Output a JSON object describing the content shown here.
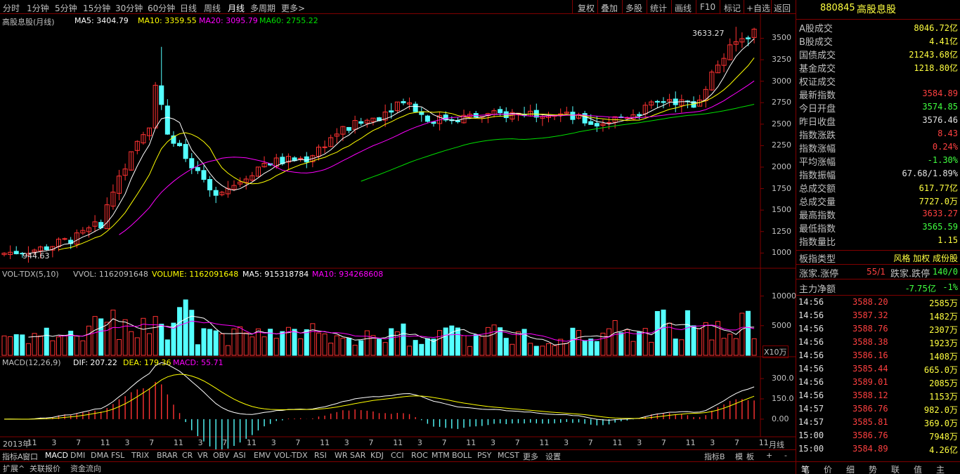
{
  "toolbar": {
    "periods": [
      "分时",
      "1分钟",
      "5分钟",
      "15分钟",
      "30分钟",
      "60分钟",
      "日线",
      "周线",
      "月线",
      "多周期",
      "更多>"
    ],
    "right": [
      "复权",
      "叠加",
      "多股",
      "统计",
      "画线",
      "F10",
      "标记",
      "+自选",
      "返回"
    ]
  },
  "main_legend": {
    "name": "高股息股(月线)",
    "ma5": "MA5: 3404.79",
    "ma10": "MA10: 3359.55",
    "ma20": "MA20: 3095.79",
    "ma60": "MA60: 2755.22"
  },
  "annotations": {
    "high": "3633.27",
    "low": "944.63"
  },
  "vol_legend": {
    "name": "VOL-TDX(5,10)",
    "vvol": "VVOL: 1162091648",
    "volume": "VOLUME: 1162091648",
    "ma5": "MA5: 915318784",
    "ma10": "MA10: 934268608"
  },
  "vol_unit": "X10万",
  "macd_legend": {
    "name": "MACD(12,26,9)",
    "dif": "DIF: 207.22",
    "dea": "DEA: 179.36",
    "macd": "MACD: 55.71"
  },
  "colors": {
    "up": "#ff3232",
    "down": "#54ffff",
    "ma5": "#ffffff",
    "ma10": "#ffff00",
    "ma20": "#ff00ff",
    "ma60": "#00e000",
    "axis": "#800000"
  },
  "chart_data": {
    "type": "candlestick",
    "title": "高股息股(月线)",
    "ylim": [
      944.63,
      3633.27
    ],
    "price_ticks": [
      "3500",
      "3250",
      "3000",
      "2750",
      "2500",
      "2250",
      "2000",
      "1750",
      "1500",
      "1250",
      "1000"
    ],
    "vol_ticks": [
      "10000",
      "5000"
    ],
    "macd_ticks": [
      "300.0",
      "150.0",
      "0.00"
    ],
    "x_ticks": [
      "2013年",
      "11",
      "3",
      "7",
      "11",
      "3",
      "7",
      "11",
      "3",
      "7",
      "11",
      "3",
      "7",
      "11",
      "3",
      "7",
      "11",
      "3",
      "7",
      "11",
      "3",
      "7",
      "11",
      "3",
      "7",
      "11",
      "3",
      "7",
      "11",
      "3",
      "7",
      "11"
    ],
    "x_period_label": "月线",
    "ma_last": {
      "MA5": 3404.79,
      "MA10": 3359.55,
      "MA20": 3095.79,
      "MA60": 2755.22
    }
  },
  "bottom_tabs": [
    "指标A",
    "窗口",
    "MACD",
    "DMI",
    "DMA",
    "FSL",
    "TRIX",
    "BRAR",
    "CR",
    "VR",
    "OBV",
    "ASI",
    "EMV",
    "VOL-TDX",
    "RSI",
    "WR",
    "SAR",
    "KDJ",
    "CCI",
    "ROC",
    "MTM",
    "BOLL",
    "PSY",
    "MCST",
    "更多",
    "设置"
  ],
  "bottom_tabs_right": [
    "指标B",
    "模",
    "板",
    "+",
    "-"
  ],
  "bottom_row2": [
    "扩展^",
    "关联报价",
    "资金流向"
  ],
  "panel": {
    "code": "880845",
    "name": "高股息股",
    "rows": [
      {
        "k": "A股成交",
        "v": "8046.72亿",
        "c": "#ffff40"
      },
      {
        "k": "B股成交",
        "v": "4.41亿",
        "c": "#ffff40"
      },
      {
        "k": "国债成交",
        "v": "21243.68亿",
        "c": "#ffff40"
      },
      {
        "k": "基金成交",
        "v": "1218.80亿",
        "c": "#ffff40"
      },
      {
        "k": "权证成交",
        "v": "",
        "c": "#ffff40"
      },
      {
        "k": "最新指数",
        "v": "3584.89",
        "c": "#ff4040"
      },
      {
        "k": "今日开盘",
        "v": "3574.85",
        "c": "#40ff40"
      },
      {
        "k": "昨日收盘",
        "v": "3576.46",
        "c": "#e0e0e0"
      },
      {
        "k": "指数涨跌",
        "v": "8.43",
        "c": "#ff4040"
      },
      {
        "k": "指数涨幅",
        "v": "0.24%",
        "c": "#ff4040"
      },
      {
        "k": "平均涨幅",
        "v": "-1.30%",
        "c": "#40ff40"
      },
      {
        "k": "指数振幅",
        "v": "67.68/1.89%",
        "c": "#e0e0e0"
      },
      {
        "k": "总成交额",
        "v": "617.77亿",
        "c": "#ffff40"
      },
      {
        "k": "总成交量",
        "v": "7727.0万",
        "c": "#ffff40"
      },
      {
        "k": "最高指数",
        "v": "3633.27",
        "c": "#ff4040"
      },
      {
        "k": "最低指数",
        "v": "3565.59",
        "c": "#40ff40"
      },
      {
        "k": "指数量比",
        "v": "1.15",
        "c": "#ffff40"
      }
    ],
    "type_row": {
      "k": "板指类型",
      "v": "风格 加权 成份股"
    },
    "updown": {
      "k1": "涨家.涨停",
      "v1": "55/1",
      "k2": "跌家.跌停",
      "v2": "140/0"
    },
    "netflow": {
      "k": "主力净额",
      "v1": "-7.75亿",
      "v2": "-1%"
    },
    "ticks": [
      {
        "t": "14:56",
        "p": "3588.20",
        "q": "2585万"
      },
      {
        "t": "14:56",
        "p": "3587.32",
        "q": "1482万"
      },
      {
        "t": "14:56",
        "p": "3588.76",
        "q": "2307万"
      },
      {
        "t": "14:56",
        "p": "3588.38",
        "q": "1923万"
      },
      {
        "t": "14:56",
        "p": "3586.16",
        "q": "1408万"
      },
      {
        "t": "14:56",
        "p": "3585.44",
        "q": "665.0万"
      },
      {
        "t": "14:56",
        "p": "3589.01",
        "q": "2085万"
      },
      {
        "t": "14:56",
        "p": "3588.12",
        "q": "1153万"
      },
      {
        "t": "14:57",
        "p": "3586.76",
        "q": "982.0万"
      },
      {
        "t": "14:57",
        "p": "3585.81",
        "q": "369.0万"
      },
      {
        "t": "15:00",
        "p": "3586.76",
        "q": "7948万"
      },
      {
        "t": "15:00",
        "p": "3584.89",
        "q": "4.26亿"
      }
    ],
    "tabs": [
      "笔",
      "价",
      "细",
      "势",
      "联",
      "值",
      "主"
    ]
  }
}
